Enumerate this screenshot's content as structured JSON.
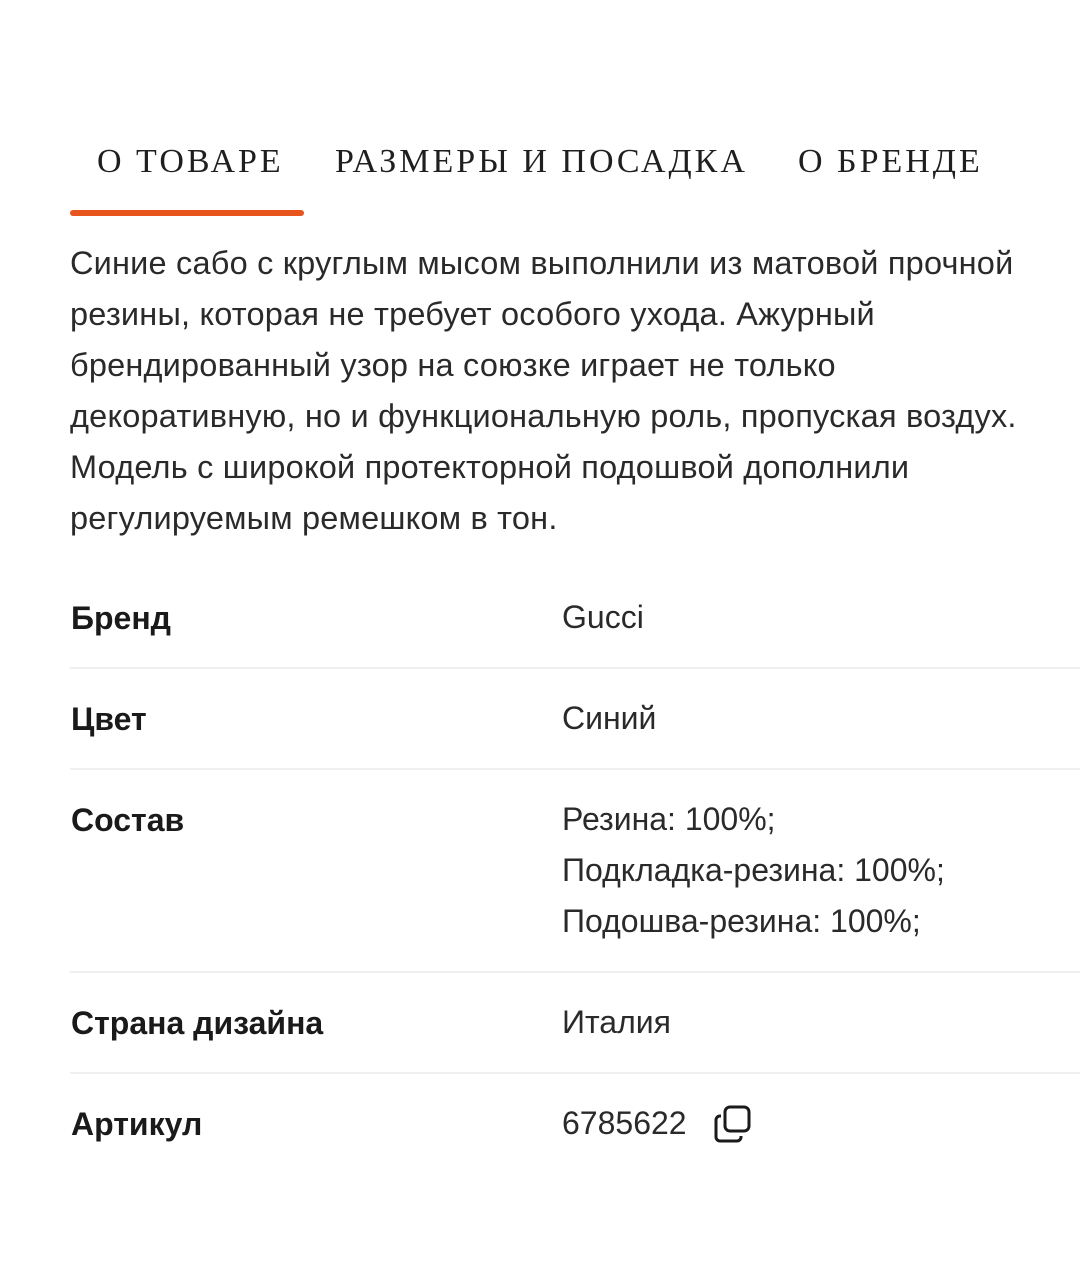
{
  "tabs": [
    {
      "label": "О ТОВАРЕ",
      "active": true
    },
    {
      "label": "РАЗМЕРЫ И ПОСАДКА",
      "active": false
    },
    {
      "label": "О БРЕНДЕ",
      "active": false
    }
  ],
  "colors": {
    "accent": "#e8541d",
    "divider": "#f0f0f0",
    "text": "#2a2a2a"
  },
  "description": "Синие сабо с круглым мысом выполнили из матовой прочной резины, которая не требует особого ухода. Ажурный брендированный узор на союзке играет не только декоративную, но и функциональную роль, пропуская воздух. Модель с широкой протекторной подошвой дополнили регулируемым ремешком в тон.",
  "specs": {
    "brand": {
      "label": "Бренд",
      "value": "Gucci"
    },
    "color": {
      "label": "Цвет",
      "value": "Синий"
    },
    "composition": {
      "label": "Состав",
      "values": [
        "Резина: 100%;",
        "Подкладка-резина: 100%;",
        "Подошва-резина: 100%;"
      ]
    },
    "design_country": {
      "label": "Страна дизайна",
      "value": "Италия"
    },
    "article": {
      "label": "Артикул",
      "value": "6785622",
      "icon": "copy-icon"
    }
  }
}
